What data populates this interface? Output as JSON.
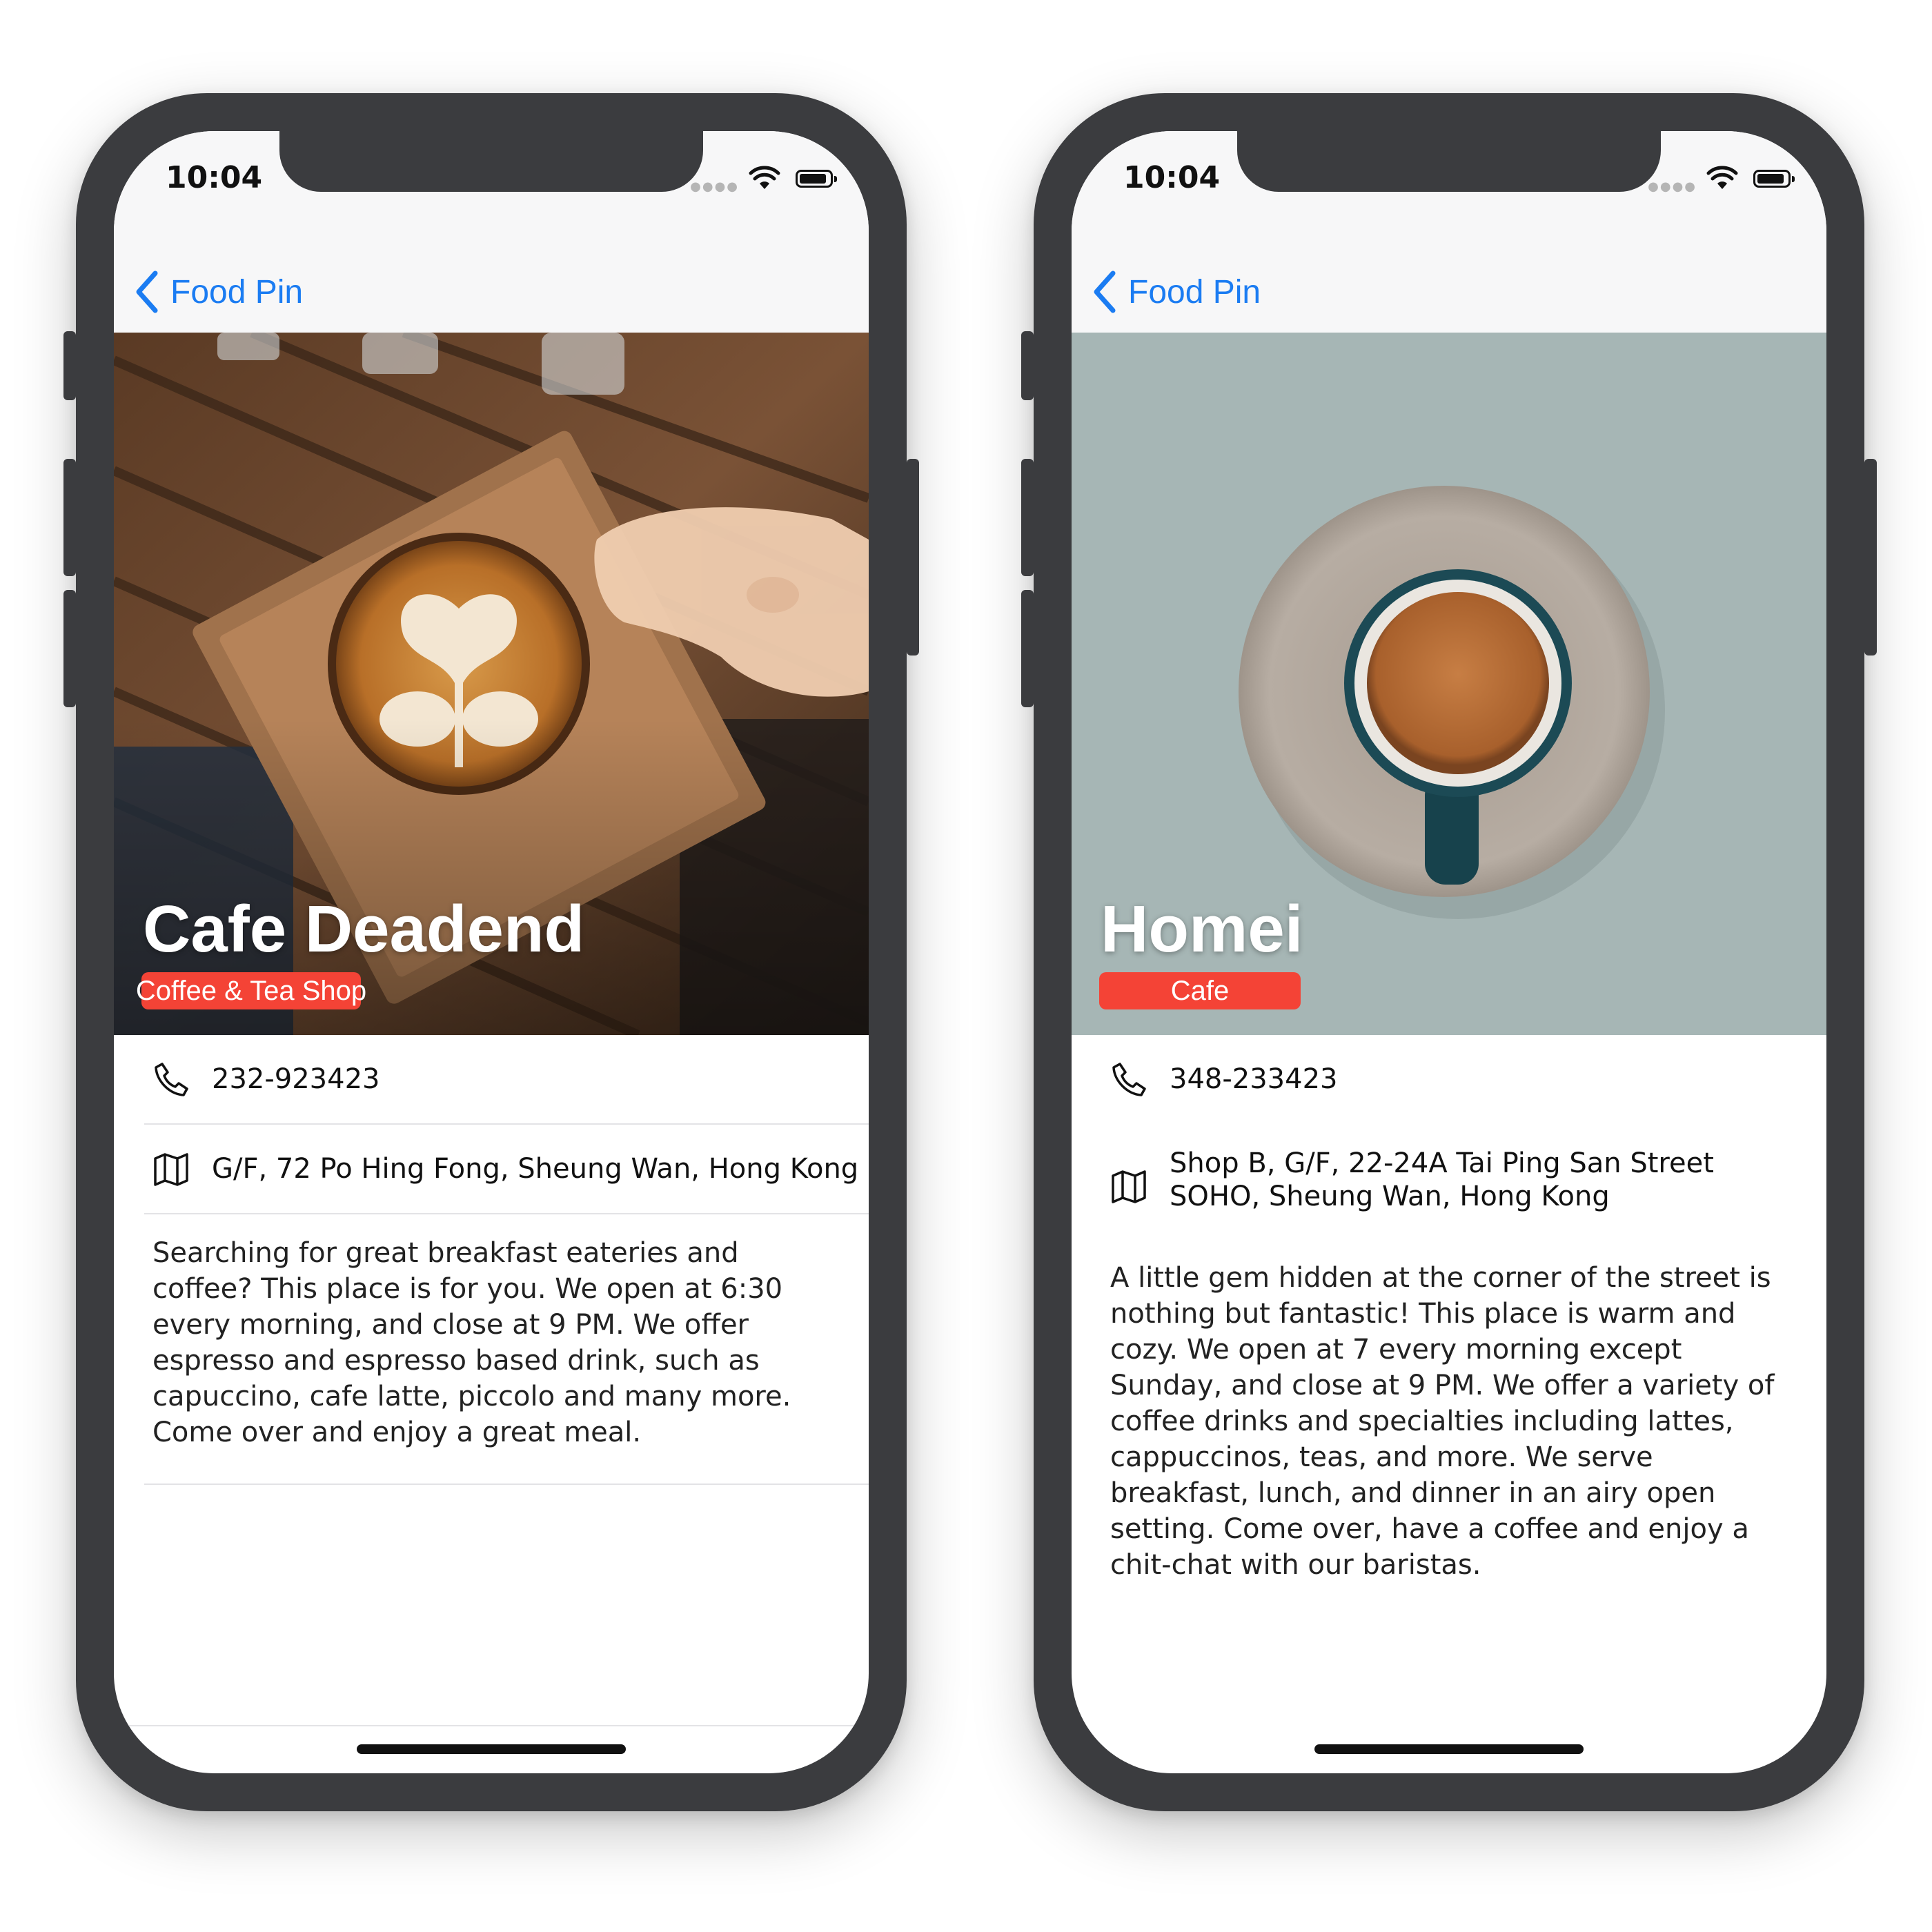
{
  "phones": [
    {
      "status": {
        "time": "10:04"
      },
      "nav": {
        "back_label": "Food Pin"
      },
      "restaurant": {
        "name": "Cafe Deadend",
        "type": "Coffee & Tea Shop",
        "phone": "232-923423",
        "address": "G/F, 72 Po Hing Fong, Sheung Wan, Hong Kong",
        "description": "Searching for great breakfast eateries and coffee? This place is for you. We open at 6:30 every morning, and close at 9 PM. We offer espresso and espresso based drink, such as capuccino, cafe latte, piccolo and many more. Come over and enjoy a great meal."
      }
    },
    {
      "status": {
        "time": "10:04"
      },
      "nav": {
        "back_label": "Food Pin"
      },
      "restaurant": {
        "name": "Homei",
        "type": "Cafe",
        "phone": "348-233423",
        "address": "Shop B, G/F, 22-24A Tai Ping San Street SOHO, Sheung Wan, Hong Kong",
        "description": "A little gem hidden at the corner of the street is nothing but fantastic! This place is warm and cozy. We open at 7 every morning except Sunday, and close at 9 PM. We offer a variety of coffee drinks and specialties including lattes, cappuccinos, teas, and more. We serve breakfast, lunch, and dinner in an airy open setting. Come over, have a coffee and enjoy a chit-chat with our baristas."
      }
    }
  ],
  "colors": {
    "accent": "#1b7cf2",
    "badge": "#f44336",
    "frame": "#3b3c3f"
  },
  "icons": [
    "chevron-left-icon",
    "phone-icon",
    "map-icon",
    "wifi-icon",
    "battery-icon"
  ]
}
